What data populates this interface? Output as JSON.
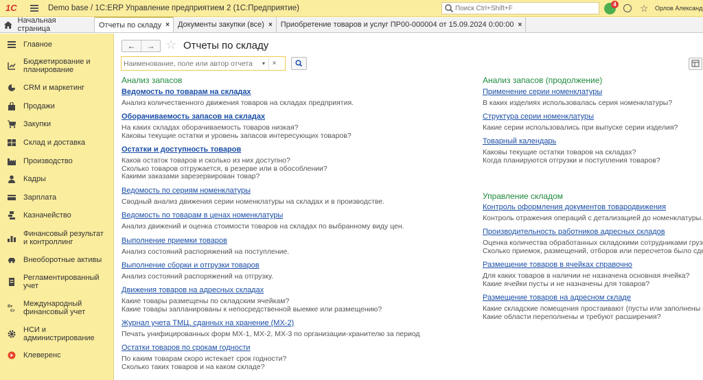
{
  "titlebar": {
    "logo": "1С",
    "title": "Demo base / 1С:ERP Управление предприятием 2  (1С:Предприятие)",
    "search_placeholder": "Поиск Ctrl+Shift+F",
    "notifications_count": "4",
    "user": "Орлов Александр"
  },
  "tabs": {
    "home": "Начальная страница",
    "items": [
      {
        "label": "Отчеты по складу",
        "active": true
      },
      {
        "label": "Документы закупки (все)",
        "active": false
      },
      {
        "label": "Приобретение товаров и услуг ПР00-000004 от 15.09.2024 0:00:00",
        "active": false
      }
    ],
    "close_glyph": "×"
  },
  "sidebar": {
    "items": [
      {
        "label": "Главное",
        "icon": "menu-icon"
      },
      {
        "label": "Бюджетирование и планирование",
        "icon": "budget-icon"
      },
      {
        "label": "CRM и маркетинг",
        "icon": "crm-icon"
      },
      {
        "label": "Продажи",
        "icon": "sales-icon"
      },
      {
        "label": "Закупки",
        "icon": "cart-icon"
      },
      {
        "label": "Склад и доставка",
        "icon": "warehouse-icon"
      },
      {
        "label": "Производство",
        "icon": "factory-icon"
      },
      {
        "label": "Кадры",
        "icon": "person-icon"
      },
      {
        "label": "Зарплата",
        "icon": "wallet-icon"
      },
      {
        "label": "Казначейство",
        "icon": "treasury-icon"
      },
      {
        "label": "Финансовый результат и контроллинг",
        "icon": "chart-icon"
      },
      {
        "label": "Внеоборотные активы",
        "icon": "car-icon"
      },
      {
        "label": "Регламентированный учет",
        "icon": "report-icon"
      },
      {
        "label": "Международный финансовый учет",
        "icon": "dr-cr-icon"
      },
      {
        "label": "НСИ и администрирование",
        "icon": "gear-icon"
      },
      {
        "label": "Клеверенс",
        "icon": "cleverence-icon"
      }
    ]
  },
  "main": {
    "title": "Отчеты по складу",
    "filter_placeholder": "Наименование, поле или автор отчета",
    "nav_back": "←",
    "nav_forward": "→",
    "left_section": {
      "title": "Анализ запасов",
      "reports": [
        {
          "name": "Ведомость по товарам на складах",
          "bold": true,
          "desc": [
            "Анализ количественного движения товаров на складах предприятия."
          ]
        },
        {
          "name": "Оборачиваемость запасов на складах",
          "bold": true,
          "desc": [
            "На каких складах оборачиваемость товаров низкая?",
            "Каковы текущие остатки и уровень запасов интересующих товаров?"
          ]
        },
        {
          "name": "Остатки и доступность товаров",
          "bold": true,
          "desc": [
            "Каков остаток товаров и сколько из них доступно?",
            "Сколько товаров отгружается, в резерве или в обособлении?",
            "Какими заказами зарезервирован товар?"
          ]
        },
        {
          "name": "Ведомость по сериям номенклатуры",
          "bold": false,
          "desc": [
            "Сводный анализ движения серии номенклатуры на складах и в производстве."
          ]
        },
        {
          "name": "Ведомость по товарам в ценах номенклатуры",
          "bold": false,
          "desc": [
            "Анализ движений и оценка стоимости товаров на складах по выбранному виду цен."
          ]
        },
        {
          "name": "Выполнение приемки товаров",
          "bold": false,
          "desc": [
            "Анализ состояний распоряжений на поступление."
          ]
        },
        {
          "name": "Выполнение сборки и отгрузки товаров",
          "bold": false,
          "desc": [
            "Анализ состояний распоряжений на отгрузку."
          ]
        },
        {
          "name": "Движения товаров на адресных складах",
          "bold": false,
          "desc": [
            "Какие товары размещены по складским ячейкам?",
            "Какие товары запланированы к непосредственной выемке или размещению?"
          ]
        },
        {
          "name": "Журнал учета ТМЦ, сданных на хранение (МХ-2)",
          "bold": false,
          "desc": [
            "Печать унифицированных форм МХ-1, МХ-2, МХ-3 по организации-хранителю за период"
          ]
        },
        {
          "name": "Остатки товаров по срокам годности",
          "bold": false,
          "desc": [
            "По каким товарам скоро истекает срок годности?",
            "Сколько таких товаров и на каком складе?"
          ]
        }
      ]
    },
    "right_section_1": {
      "title": "Анализ запасов (продолжение)",
      "reports": [
        {
          "name": "Применение серии номенклатуры",
          "desc": [
            "В каких изделиях использовалась серия номенклатуры?"
          ]
        },
        {
          "name": "Структура серии номенклатуры",
          "desc": [
            "Какие серии использовались при выпуске серии изделия?"
          ]
        },
        {
          "name": "Товарный календарь",
          "desc": [
            "Каковы текущие остатки товаров на складах?",
            "Когда планируются отгрузки и поступления товаров?"
          ]
        }
      ]
    },
    "right_section_2": {
      "title": "Управление складом",
      "reports": [
        {
          "name": "Контроль оформления документов товародвижения",
          "desc": [
            "Контроль отражения операций с детализацией до номенклатуры."
          ]
        },
        {
          "name": "Производительность работников адресных складов",
          "desc": [
            "Оценка количества обработанных складскими сотрудниками грузов",
            "Сколько приемок, размещений, отборов или пересчетов было сдел"
          ]
        },
        {
          "name": "Размещение товаров в ячейках справочно",
          "desc": [
            "Для каких товаров в наличии не назначена основная ячейка?",
            "Какие ячейки пусты и не назначены для товаров?"
          ]
        },
        {
          "name": "Размещение товаров на адресном складе",
          "desc": [
            "Какие складские помещения простаивают (пусты или заполнены н",
            "Какие области переполнены и требуют расширения?"
          ]
        }
      ]
    }
  }
}
